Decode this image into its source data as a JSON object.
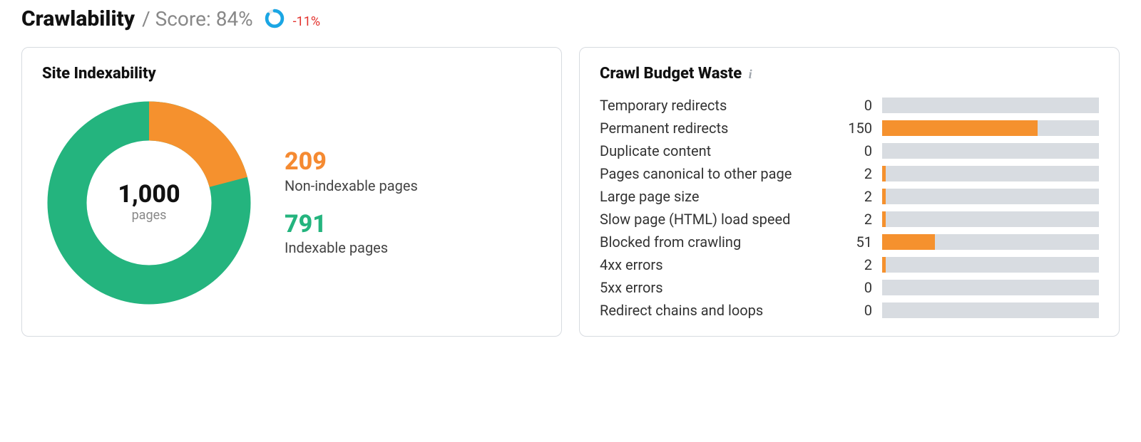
{
  "header": {
    "title": "Crawlability",
    "score_prefix": "/ Score: ",
    "score_value": "84%",
    "score_delta": "-11%",
    "score_donut_percent": 84,
    "colors": {
      "donut_fg": "#1aa6e4",
      "donut_bg": "#e6e8ea",
      "delta": "#e3342f"
    }
  },
  "indexability": {
    "title": "Site Indexability",
    "total": "1,000",
    "total_label": "pages",
    "segments": [
      {
        "key": "non_indexable",
        "value": 209,
        "label": "Non-indexable pages",
        "color": "#f5912e"
      },
      {
        "key": "indexable",
        "value": 791,
        "label": "Indexable pages",
        "color": "#24b47e"
      }
    ]
  },
  "crawl_budget": {
    "title": "Crawl Budget Waste",
    "bar_max": 209,
    "items": [
      {
        "label": "Temporary redirects",
        "value": 0
      },
      {
        "label": "Permanent redirects",
        "value": 150
      },
      {
        "label": "Duplicate content",
        "value": 0
      },
      {
        "label": "Pages canonical to other page",
        "value": 2
      },
      {
        "label": "Large page size",
        "value": 2
      },
      {
        "label": "Slow page (HTML) load speed",
        "value": 2
      },
      {
        "label": "Blocked from crawling",
        "value": 51
      },
      {
        "label": "4xx errors",
        "value": 2
      },
      {
        "label": "5xx errors",
        "value": 0
      },
      {
        "label": "Redirect chains and loops",
        "value": 0
      }
    ]
  },
  "chart_data": [
    {
      "type": "pie",
      "title": "Site Indexability",
      "total_label": "1,000 pages",
      "series": [
        {
          "name": "Non-indexable pages",
          "value": 209,
          "color": "#f5912e"
        },
        {
          "name": "Indexable pages",
          "value": 791,
          "color": "#24b47e"
        }
      ]
    },
    {
      "type": "bar",
      "title": "Crawl Budget Waste",
      "categories": [
        "Temporary redirects",
        "Permanent redirects",
        "Duplicate content",
        "Pages canonical to other page",
        "Large page size",
        "Slow page (HTML) load speed",
        "Blocked from crawling",
        "4xx errors",
        "5xx errors",
        "Redirect chains and loops"
      ],
      "values": [
        0,
        150,
        0,
        2,
        2,
        2,
        51,
        2,
        0,
        0
      ],
      "xlabel": "",
      "ylabel": "",
      "ylim": [
        0,
        209
      ]
    }
  ]
}
